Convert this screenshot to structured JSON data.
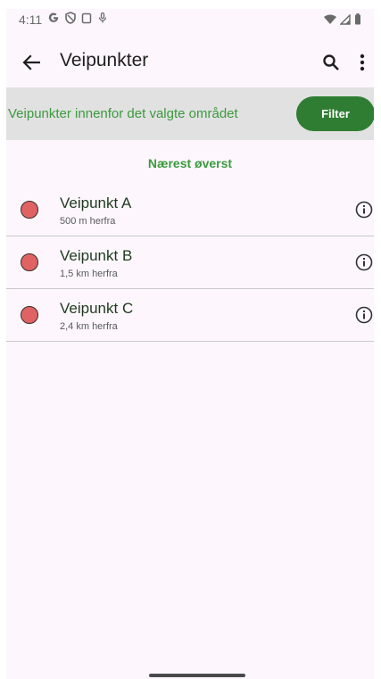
{
  "status_bar": {
    "time": "4:11",
    "icons": [
      "google-icon",
      "shield-icon",
      "screenshot-icon",
      "mic-icon",
      "wifi-icon",
      "signal-icon",
      "battery-icon"
    ]
  },
  "app_bar": {
    "title": "Veipunkter",
    "icons": [
      "back-arrow-icon",
      "search-icon",
      "more-vert-icon"
    ]
  },
  "filter_banner": {
    "text": "Veipunkter innenfor det valgte området",
    "button_label": "Filter"
  },
  "sort_label": "Nærest øverst",
  "waypoints": [
    {
      "name": "Veipunkt A",
      "distance": "500 m herfra"
    },
    {
      "name": "Veipunkt B",
      "distance": "1,5 km herfra"
    },
    {
      "name": "Veipunkt C",
      "distance": "2,4 km herfra"
    }
  ],
  "colors": {
    "accent_green": "#3b9a3e",
    "button_green": "#2e7d32",
    "marker_red": "#e06363",
    "banner_gray": "#e1e1e1",
    "background": "#fdf7fd"
  }
}
